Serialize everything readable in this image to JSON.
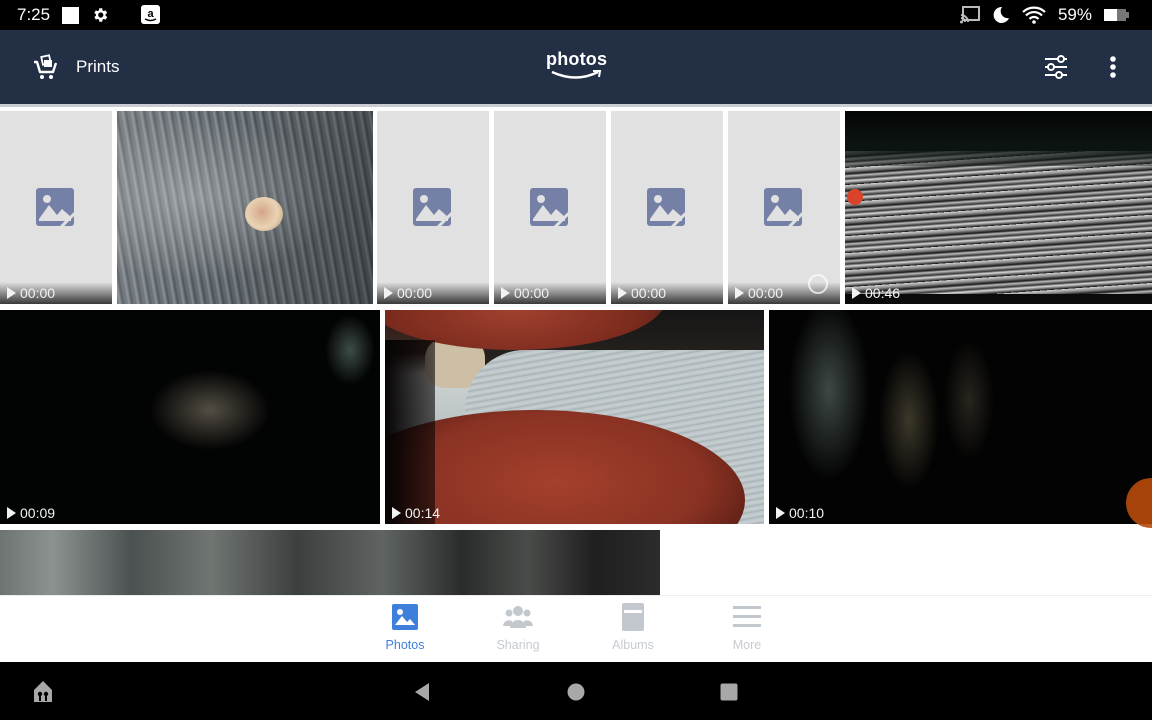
{
  "status_bar": {
    "time": "7:25",
    "battery_percent": "59%",
    "battery_level": 0.59,
    "icons": [
      "square-notification-icon",
      "settings-gear-icon",
      "amazon-app-icon",
      "cast-icon",
      "do-not-disturb-moon-icon",
      "wifi-icon",
      "battery-icon"
    ]
  },
  "header": {
    "prints_label": "Prints",
    "logo_text": "photos",
    "actions": [
      "filter-sliders-icon",
      "more-vertical-icon"
    ],
    "background_color": "#232f45"
  },
  "grid": {
    "rows": [
      {
        "tiles": [
          {
            "kind": "placeholder",
            "duration": "00:00"
          },
          {
            "kind": "video",
            "thumbnail": "knit-fabric-with-button",
            "duration": "00:00"
          },
          {
            "kind": "placeholder",
            "duration": "00:00"
          },
          {
            "kind": "placeholder",
            "duration": "00:00"
          },
          {
            "kind": "placeholder",
            "duration": "00:00"
          },
          {
            "kind": "placeholder",
            "duration": "00:00",
            "loading": true
          },
          {
            "kind": "video",
            "thumbnail": "black-white-streaks",
            "duration": "00:46"
          }
        ]
      },
      {
        "tiles": [
          {
            "kind": "video",
            "thumbnail": "dark-blurry",
            "duration": "00:09"
          },
          {
            "kind": "video",
            "thumbnail": "room-with-finger-over-lens",
            "duration": "00:14"
          },
          {
            "kind": "video",
            "thumbnail": "dark-blurry-streaks",
            "duration": "00:10"
          }
        ]
      },
      {
        "tiles": [
          {
            "kind": "video",
            "thumbnail": "grey-blur-partial"
          }
        ]
      }
    ]
  },
  "tabs": [
    {
      "label": "Photos",
      "icon": "photos-icon",
      "active": true
    },
    {
      "label": "Sharing",
      "icon": "people-icon",
      "active": false
    },
    {
      "label": "Albums",
      "icon": "album-icon",
      "active": false
    },
    {
      "label": "More",
      "icon": "hamburger-menu-icon",
      "active": false
    }
  ],
  "accent_color": "#3f7fdc",
  "nav_bar": {
    "buttons": [
      "home-launcher-icon",
      "back-icon",
      "home-icon",
      "recents-icon"
    ]
  }
}
